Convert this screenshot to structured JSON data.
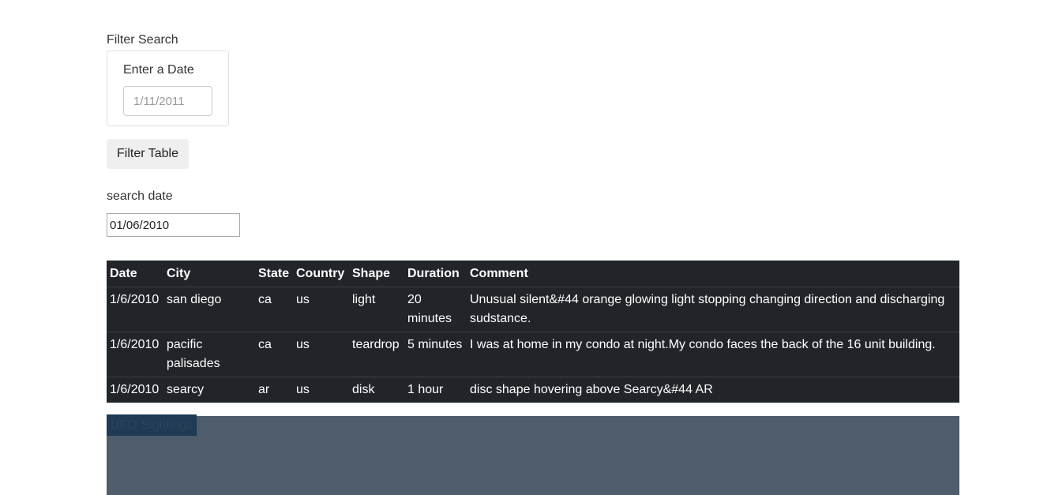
{
  "filter": {
    "title": "Filter Search",
    "date_label": "Enter a Date",
    "date_placeholder": "1/11/2011",
    "button_label": "Filter Table"
  },
  "search": {
    "label": "search date",
    "value": "01/06/2010"
  },
  "table": {
    "headers": [
      "Date",
      "City",
      "State",
      "Country",
      "Shape",
      "Duration",
      "Comment"
    ],
    "rows": [
      {
        "date": "1/6/2010",
        "city": "san diego",
        "state": "ca",
        "country": "us",
        "shape": "light",
        "duration": "20 minutes",
        "comment": "Unusual silent&#44 orange glowing light stopping changing direction and discharging sudstance."
      },
      {
        "date": "1/6/2010",
        "city": "pacific palisades",
        "state": "ca",
        "country": "us",
        "shape": "teardrop",
        "duration": "5 minutes",
        "comment": "I was at home in my condo at night.My condo faces the back of the 16 unit building."
      },
      {
        "date": "1/6/2010",
        "city": "searcy",
        "state": "ar",
        "country": "us",
        "shape": "disk",
        "duration": "1 hour",
        "comment": "disc shape hovering above Searcy&#44 AR"
      }
    ]
  },
  "panel": {
    "tab_label": "UFO Sightings"
  },
  "colors": {
    "table_bg": "#212529",
    "panel_bg": "#4f5c6b",
    "tab_bg": "#1e3a55"
  }
}
